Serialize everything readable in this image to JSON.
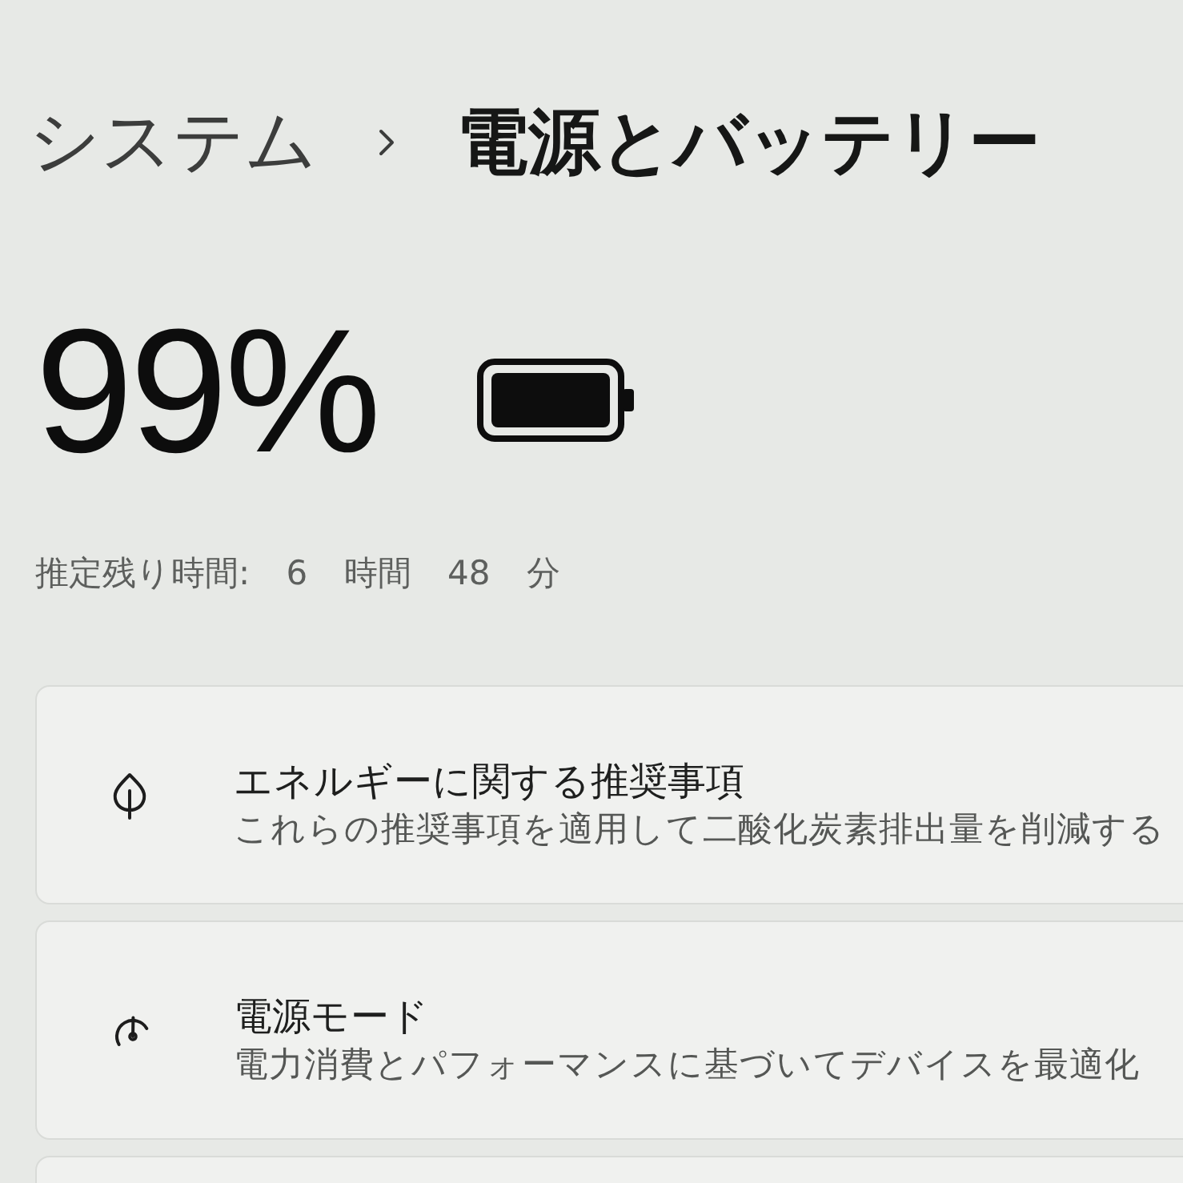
{
  "breadcrumb": {
    "parent": "システム",
    "current": "電源とバッテリー"
  },
  "battery": {
    "percent": "99%",
    "estimate": "推定残り時間: 6 時間 48 分"
  },
  "cards": [
    {
      "kind": "leaf",
      "title": "エネルギーに関する推奨事項",
      "subtitle": "これらの推奨事項を適用して二酸化炭素排出量を削減する"
    },
    {
      "kind": "gauge",
      "title": "電源モード",
      "subtitle": "電力消費とパフォーマンスに基づいてデバイスを最適化"
    },
    {
      "kind": "blank"
    }
  ]
}
